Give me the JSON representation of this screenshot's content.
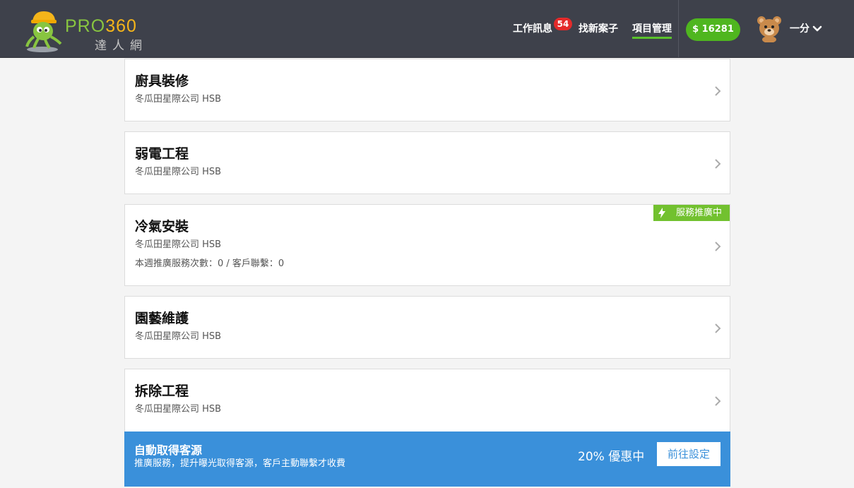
{
  "header": {
    "logo": {
      "brand_pro": "PRO",
      "brand_num": "360",
      "subtitle": "達人網"
    },
    "nav": {
      "messages_label": "工作訊息",
      "messages_badge": "54",
      "find_cases_label": "找新案子",
      "project_management_label": "項目管理"
    },
    "balance": "$ 16281",
    "user": {
      "name": "一分"
    }
  },
  "projects": [
    {
      "title": "廚具裝修",
      "company": "冬瓜田星際公司 HSB"
    },
    {
      "title": "弱電工程",
      "company": "冬瓜田星際公司 HSB"
    },
    {
      "title": "冷氣安裝",
      "company": "冬瓜田星際公司 HSB",
      "promo_tag": "服務推廣中",
      "stats": "本週推廣服務次數：0 / 客戶聯繫：0"
    },
    {
      "title": "園藝維護",
      "company": "冬瓜田星際公司 HSB"
    },
    {
      "title": "拆除工程",
      "company": "冬瓜田星際公司 HSB"
    }
  ],
  "banner": {
    "title": "自動取得客源",
    "description": "推廣服務，提升曝光取得客源，客戶主動聯繫才收費",
    "discount": "20% 優惠中",
    "button_label": "前往設定"
  },
  "colors": {
    "header_bg": "#3e414b",
    "accent_green": "#5bc22c",
    "badge_red": "#e42a2a",
    "banner_blue": "#3a90da",
    "promo_green": "#72c12f"
  },
  "icons": [
    "mascot-logo-icon",
    "avatar-bear-icon",
    "chevron-down-icon",
    "chevron-right-icon",
    "lightning-icon"
  ]
}
